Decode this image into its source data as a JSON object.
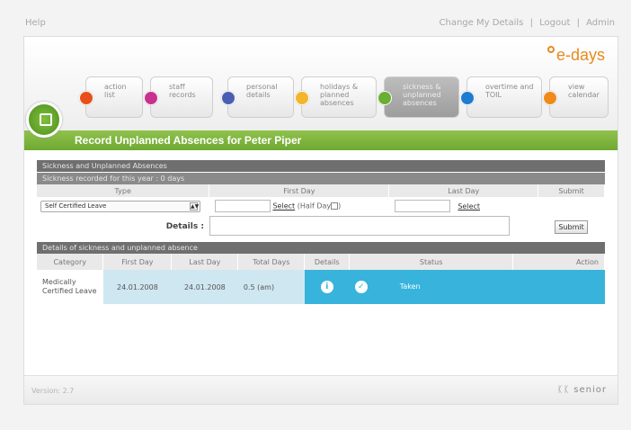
{
  "topbar": {
    "help": "Help",
    "change_details": "Change My Details",
    "logout": "Logout",
    "admin": "Admin"
  },
  "logo": {
    "text": "e-days",
    "color": "#e98a1c"
  },
  "nav": [
    {
      "label": "action list",
      "icon": "lock-icon",
      "color": "#e8501a"
    },
    {
      "label": "staff records",
      "icon": "users-icon",
      "color": "#c8328e"
    },
    {
      "label": "personal details",
      "icon": "info-icon",
      "color": "#4a5fb3"
    },
    {
      "label": "holidays & planned absences",
      "icon": "sun-icon",
      "color": "#f1b62b"
    },
    {
      "label": "sickness & unplanned absences",
      "icon": "medical-kit-icon",
      "color": "#6aae33"
    },
    {
      "label": "overtime and TOIL",
      "icon": "clock-icon",
      "color": "#1d7bd0"
    },
    {
      "label": "view calendar",
      "icon": "calendar-icon",
      "color": "#f08a1a"
    }
  ],
  "page_title": "Record Unplanned Absences for Peter Piper",
  "section1": {
    "title": "Sickness and Unplanned Absences",
    "subtitle": "Sickness recorded for this year : 0 days",
    "headers": {
      "type": "Type",
      "first_day": "First Day",
      "last_day": "Last Day",
      "submit": "Submit"
    },
    "type_value": "Self Certified Leave",
    "select_label": "Select",
    "half_day_label": "(Half Day",
    "half_day_close": ")",
    "last_select_label": "Select",
    "details_label": "Details :",
    "submit_button": "Submit"
  },
  "section2": {
    "title": "Details of sickness and unplanned absence",
    "headers": [
      "Category",
      "First Day",
      "Last Day",
      "Total Days",
      "Details",
      "Status",
      "Action"
    ],
    "row": {
      "category": "Medically Certified Leave",
      "first_day": "24.01.2008",
      "last_day": "24.01.2008",
      "total_days": "0.5 (am)",
      "status": "Taken"
    }
  },
  "footer": {
    "version": "Version: 2.7",
    "brand": "senior"
  }
}
